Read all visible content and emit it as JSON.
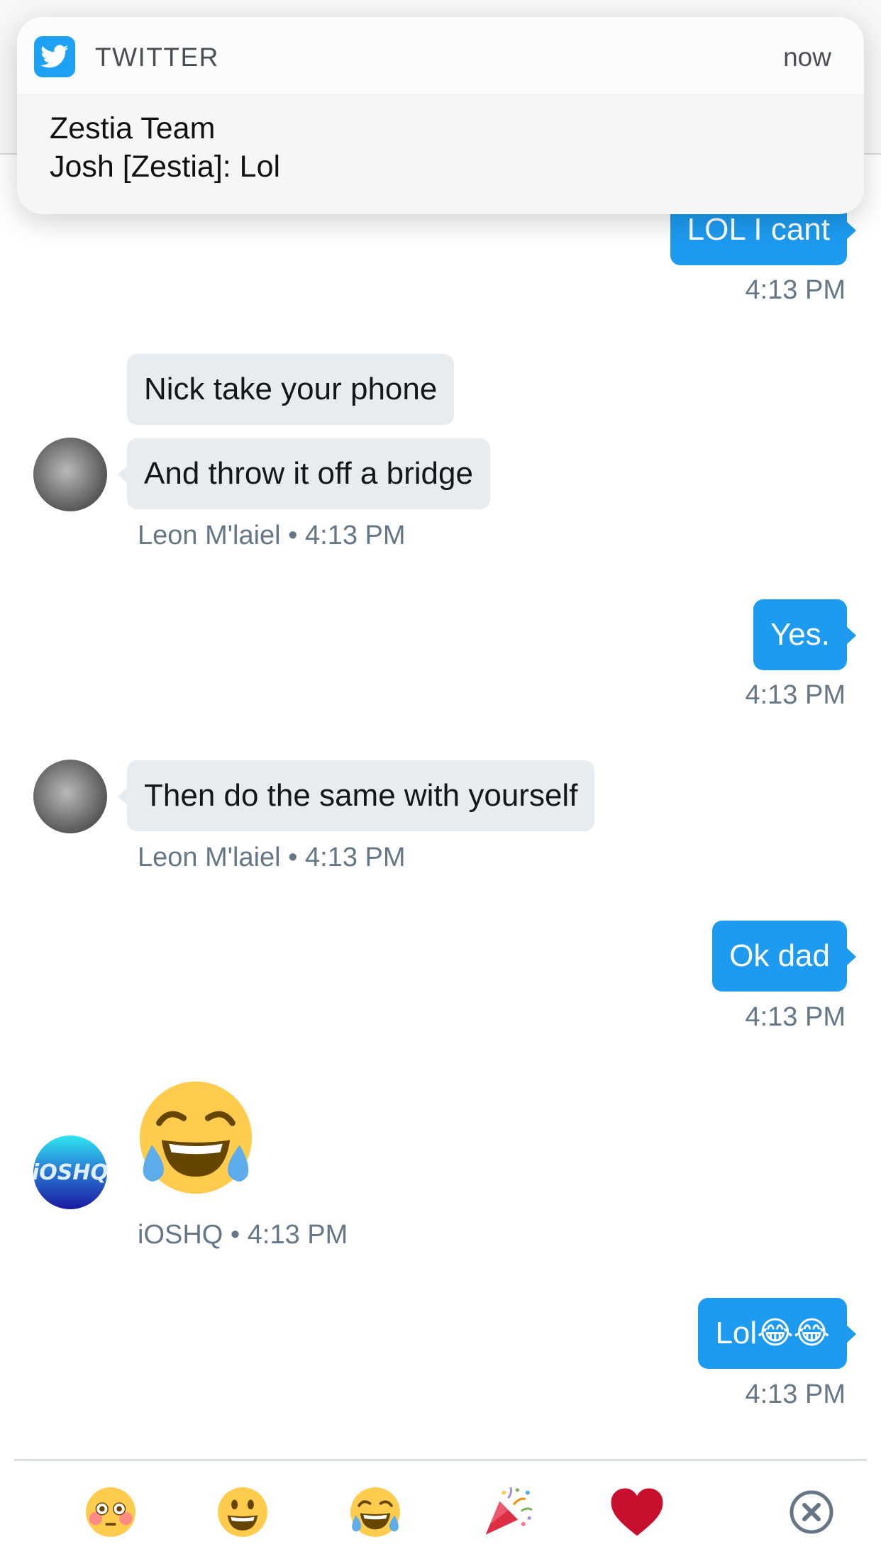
{
  "notification": {
    "app_name": "TWITTER",
    "time": "now",
    "title": "Zestia Team",
    "message": "Josh [Zestia]: Lol",
    "app_icon": "twitter-bird-icon"
  },
  "messages": [
    {
      "direction": "outgoing",
      "text": "LOL I cant",
      "meta": "4:13 PM"
    },
    {
      "direction": "incoming",
      "text": "Nick take your phone"
    },
    {
      "direction": "incoming",
      "text": "And throw it off a bridge",
      "meta": "Leon M'laiel • 4:13 PM"
    },
    {
      "direction": "outgoing",
      "text": "Yes.",
      "meta": "4:13 PM"
    },
    {
      "direction": "incoming",
      "text": "Then do the same with yourself",
      "meta": "Leon M'laiel • 4:13 PM"
    },
    {
      "direction": "outgoing",
      "text": "Ok dad",
      "meta": "4:13 PM"
    },
    {
      "direction": "incoming",
      "emoji": "face-with-tears-of-joy",
      "meta": "iOSHQ • 4:13 PM"
    },
    {
      "direction": "outgoing",
      "text": "Lol😂😂",
      "meta": "4:13 PM"
    }
  ],
  "avatars": {
    "ioshq_text": "iOSHQ"
  },
  "reactions": [
    {
      "name": "flushed-face-icon"
    },
    {
      "name": "grinning-face-icon"
    },
    {
      "name": "tears-of-joy-icon"
    },
    {
      "name": "party-popper-icon"
    },
    {
      "name": "red-heart-icon"
    },
    {
      "name": "close-circle-icon"
    }
  ],
  "colors": {
    "accent": "#1d9bf0",
    "incoming_bubble": "#e6ecf0",
    "meta_text": "#657786",
    "heart": "#c8102e"
  }
}
